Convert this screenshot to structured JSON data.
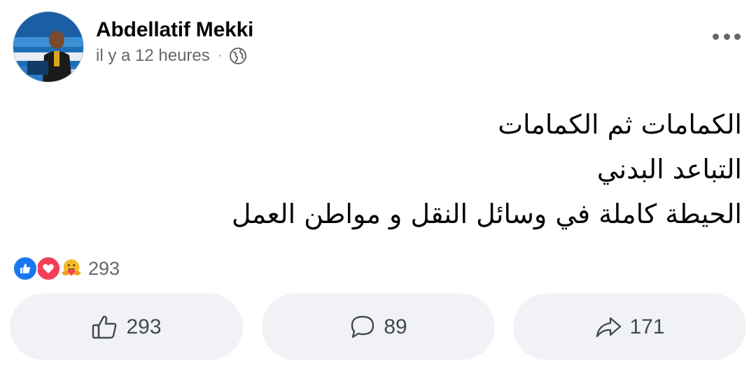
{
  "post": {
    "author": "Abdellatif Mekki",
    "timestamp": "il y a 12 heures",
    "separator": "·",
    "privacy_icon": "globe-icon",
    "more_icon": "more-options-icon",
    "text_lines": [
      "الكمامات ثم الكمامات",
      "التباعد البدني",
      "الحيطة كاملة في وسائل النقل و مواطن العمل"
    ]
  },
  "reactions": {
    "icons": [
      "like-reaction-icon",
      "love-reaction-icon",
      "care-reaction-icon"
    ],
    "count": "293"
  },
  "actions": {
    "like": {
      "icon": "thumbs-up-icon",
      "count": "293"
    },
    "comment": {
      "icon": "comment-icon",
      "count": "89"
    },
    "share": {
      "icon": "share-icon",
      "count": "171"
    }
  },
  "colors": {
    "like_blue": "#1877f2",
    "love_red": "#f33e58",
    "care_yellow": "#f7b928",
    "secondary_text": "#65676b",
    "button_bg": "#f0f2f5"
  }
}
